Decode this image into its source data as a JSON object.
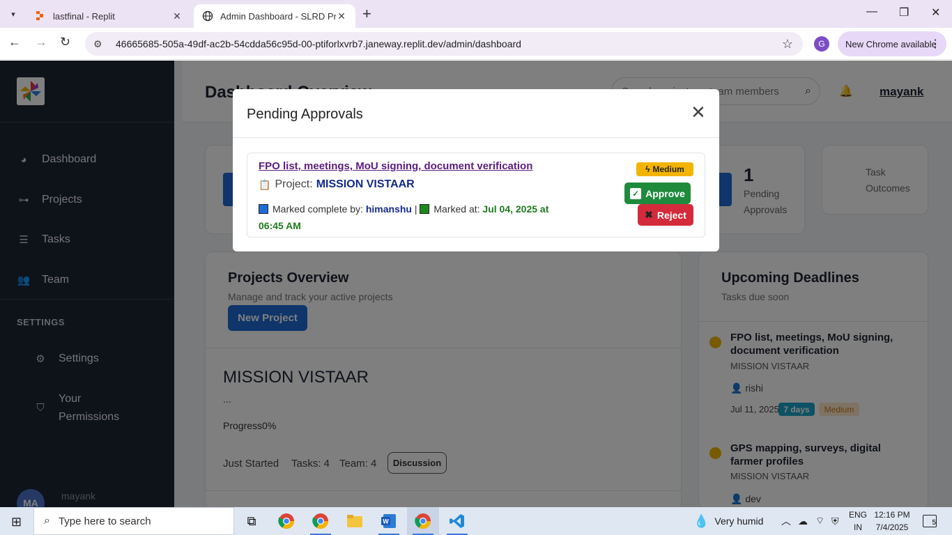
{
  "browser": {
    "tabs": [
      {
        "title": "lastfinal - Replit",
        "close": "✕"
      },
      {
        "title": "Admin Dashboard - SLRD Proje",
        "close": "✕"
      }
    ],
    "new_tab": "+",
    "url": "46665685-505a-49df-ac2b-54cdda56c95d-00-ptiforlxvrb7.janeway.replit.dev/admin/dashboard",
    "profile_initial": "G",
    "new_chrome_label": "New Chrome available",
    "window_controls": {
      "minimize": "—",
      "maximize": "❐",
      "close": "✕"
    }
  },
  "sidebar": {
    "items": [
      {
        "label": "Dashboard",
        "icon": "palette-icon"
      },
      {
        "label": "Projects",
        "icon": "project-diagram-icon"
      },
      {
        "label": "Tasks",
        "icon": "tasks-icon"
      },
      {
        "label": "Team",
        "icon": "users-icon"
      }
    ],
    "section_label": "SETTINGS",
    "settings_items": [
      {
        "label": "Settings",
        "icon": "gear-icon"
      },
      {
        "label": "Your Permissions",
        "icon": "shield-icon"
      }
    ],
    "user_initials": "MA",
    "user_name": "mayank"
  },
  "header": {
    "title": "Dashboard Overview",
    "search_placeholder": "Search projects or team members",
    "user": "mayank"
  },
  "stats": {
    "pending_count": "1",
    "pending_label_line1": "Pending",
    "pending_label_line2": "Approvals",
    "outcomes_line1": "Task",
    "outcomes_line2": "Outcomes"
  },
  "projects_overview": {
    "title": "Projects Overview",
    "subtitle": "Manage and track your active projects",
    "new_project_label": "New Project",
    "project": {
      "name": "MISSION VISTAAR",
      "description": "...",
      "progress_label": "Progress",
      "progress_value": "0%",
      "status": "Just Started",
      "tasks": "Tasks: 4",
      "team": "Team: 4",
      "discussion_label": "Discussion"
    }
  },
  "deadlines": {
    "title": "Upcoming Deadlines",
    "subtitle": "Tasks due soon",
    "items": [
      {
        "title": "FPO list, meetings, MoU signing, document verification",
        "project": "MISSION VISTAAR",
        "assignee": "rishi",
        "date": "Jul 11, 2025",
        "days": "7 days",
        "priority": "Medium"
      },
      {
        "title": "GPS mapping, surveys, digital farmer profiles",
        "project": "MISSION VISTAAR",
        "assignee": "dev"
      }
    ]
  },
  "modal": {
    "title": "Pending Approvals",
    "close": "✕",
    "approval": {
      "task_title": "FPO list, meetings, MoU signing, document verification",
      "project_label": "Project:",
      "project_name": "MISSION VISTAAR",
      "completed_by_label": "Marked complete by:",
      "completed_by": "himanshu",
      "separator": "|",
      "marked_at_label": "Marked at:",
      "marked_at": "Jul 04, 2025 at 06:45 AM",
      "priority": "Medium",
      "approve_label": "Approve",
      "reject_label": "Reject"
    }
  },
  "taskbar": {
    "search_placeholder": "Type here to search",
    "weather": "Very humid",
    "lang_line1": "ENG",
    "lang_line2": "IN",
    "time": "12:16 PM",
    "date": "7/4/2025",
    "notifications": "5"
  },
  "colors": {
    "sidebar_bg": "#1d2433",
    "primary": "#1e6bd6",
    "approve": "#1e8a3c",
    "reject": "#d42b3c",
    "warning": "#f3b400",
    "info": "#1aa3c9",
    "browser_frame": "#ece3f5"
  }
}
